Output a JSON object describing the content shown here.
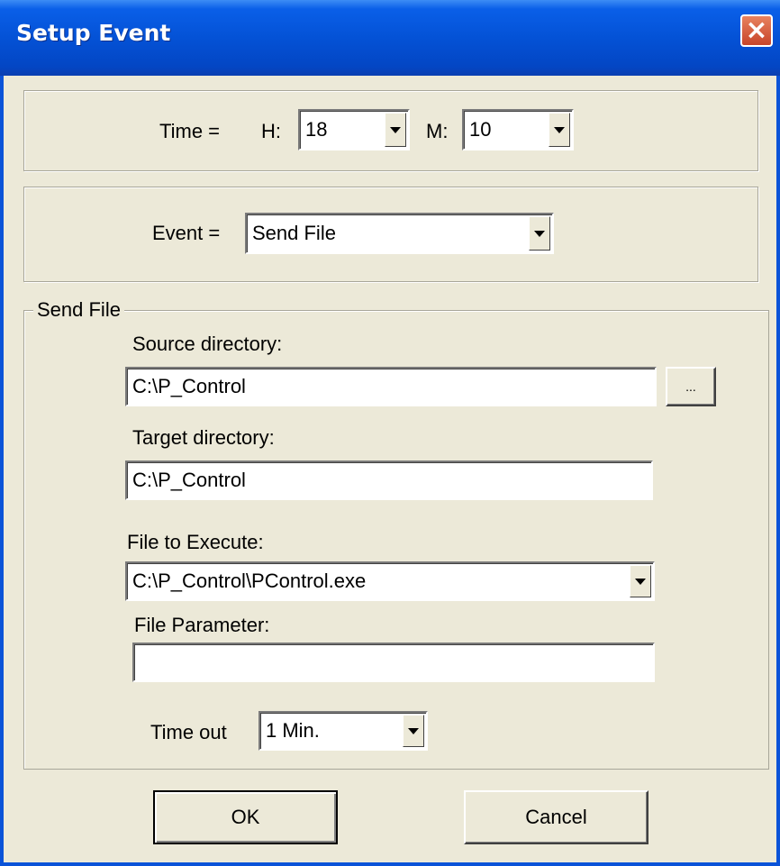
{
  "window": {
    "title": "Setup Event",
    "close_icon": "close-icon"
  },
  "time": {
    "label": "Time =",
    "hour_label": "H:",
    "hour_value": "18",
    "minute_label": "M:",
    "minute_value": "10"
  },
  "event": {
    "label": "Event =",
    "value": "Send File"
  },
  "send_file": {
    "group_label": "Send File",
    "source_label": "Source directory:",
    "source_value": "C:\\P_Control",
    "browse_label": "...",
    "target_label": "Target directory:",
    "target_value": "C:\\P_Control",
    "execute_label": "File to Execute:",
    "execute_value": "C:\\P_Control\\PControl.exe",
    "param_label": "File Parameter:",
    "param_value": "",
    "timeout_label": "Time out",
    "timeout_value": "1 Min."
  },
  "buttons": {
    "ok": "OK",
    "cancel": "Cancel"
  }
}
